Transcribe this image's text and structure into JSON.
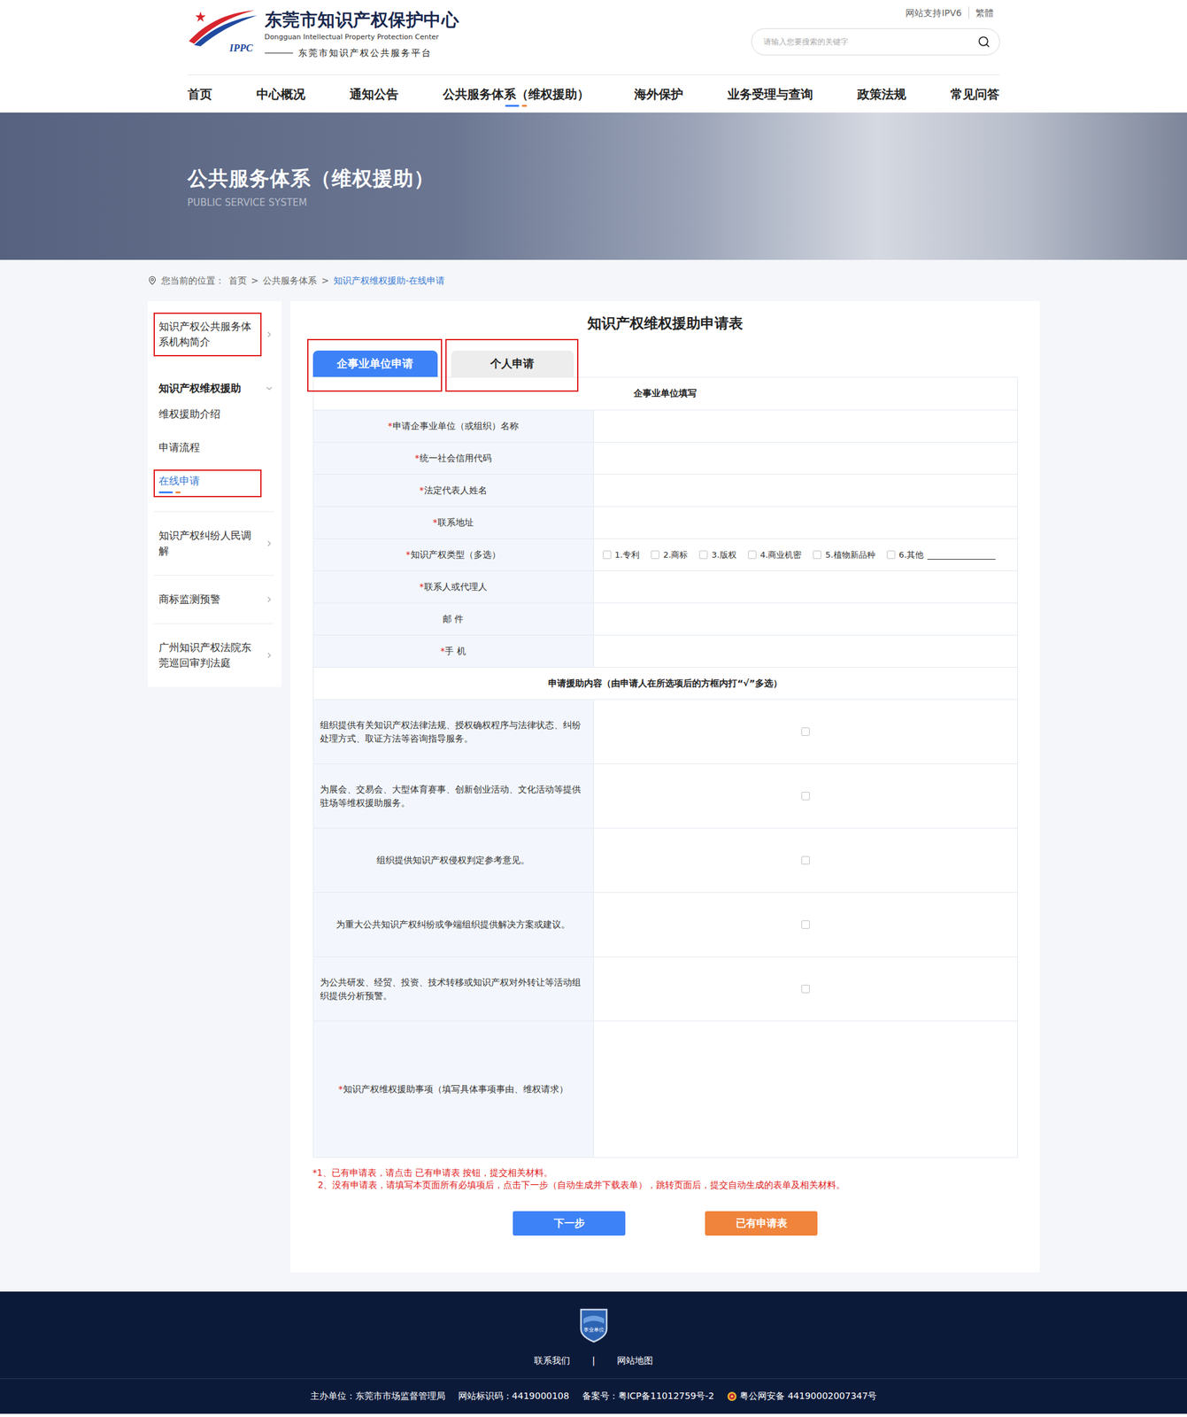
{
  "header": {
    "logo": {
      "badge": "IPPC",
      "title": "东莞市知识产权保护中心",
      "subtitle": "Dongguan Intellectual Property Protection Center",
      "platform": "东莞市知识产权公共服务平台"
    },
    "top_links": [
      "网站支持IPV6",
      "繁體"
    ],
    "search": {
      "placeholder": "请输入您要搜索的关键字"
    }
  },
  "nav": [
    {
      "label": "首页",
      "selected": false
    },
    {
      "label": "中心概况",
      "selected": false
    },
    {
      "label": "通知公告",
      "selected": false
    },
    {
      "label": "公共服务体系（维权援助）",
      "selected": true
    },
    {
      "label": "海外保护",
      "selected": false
    },
    {
      "label": "业务受理与查询",
      "selected": false
    },
    {
      "label": "政策法规",
      "selected": false
    },
    {
      "label": "常见问答",
      "selected": false
    }
  ],
  "banner": {
    "title": "公共服务体系（维权援助）",
    "subtitle": "PUBLIC SERVICE SYSTEM"
  },
  "breadcrumb": {
    "prefix": "您当前的位置：",
    "separator": ">",
    "items": [
      {
        "label": "首页",
        "current": false
      },
      {
        "label": "公共服务体系",
        "current": false
      },
      {
        "label": "知识产权维权援助-在线申请",
        "current": true
      }
    ]
  },
  "sidebar": {
    "items": [
      {
        "label": "知识产权公共服务体系机构简介",
        "kind": "link",
        "expanded": false,
        "annotated": true,
        "children": []
      },
      {
        "label": "知识产权维权援助",
        "kind": "group",
        "expanded": true,
        "annotated": false,
        "children": [
          {
            "label": "维权援助介绍",
            "selected": false,
            "annotated": false
          },
          {
            "label": "申请流程",
            "selected": false,
            "annotated": false
          },
          {
            "label": "在线申请",
            "selected": true,
            "annotated": true
          }
        ]
      },
      {
        "label": "知识产权纠纷人民调解",
        "kind": "link",
        "expanded": false,
        "annotated": false,
        "children": []
      },
      {
        "label": "商标监测预警",
        "kind": "link",
        "expanded": false,
        "annotated": false,
        "children": []
      },
      {
        "label": "广州知识产权法院东莞巡回审判法庭",
        "kind": "link",
        "expanded": false,
        "annotated": false,
        "children": []
      }
    ]
  },
  "form": {
    "title": "知识产权维权援助申请表",
    "required_mark": "*",
    "tabs": [
      {
        "label": "企事业单位申请",
        "selected": true,
        "annotated": true
      },
      {
        "label": "个人申请",
        "selected": false,
        "annotated": true
      }
    ],
    "section": "企事业单位填写",
    "fields": [
      {
        "label": "申请企事业单位（或组织）名称",
        "required": true,
        "kind": "text",
        "value": "",
        "options": []
      },
      {
        "label": "统一社会信用代码",
        "required": true,
        "kind": "text",
        "value": "",
        "options": []
      },
      {
        "label": "法定代表人姓名",
        "required": true,
        "kind": "text",
        "value": "",
        "options": []
      },
      {
        "label": "联系地址",
        "required": true,
        "kind": "text",
        "value": "",
        "options": []
      },
      {
        "label": "知识产权类型（多选）",
        "required": true,
        "kind": "options",
        "value": "",
        "options": [
          {
            "label": "1.专利",
            "checked": false,
            "blank": false
          },
          {
            "label": "2.商标",
            "checked": false,
            "blank": false
          },
          {
            "label": "3.版权",
            "checked": false,
            "blank": false
          },
          {
            "label": "4.商业机密",
            "checked": false,
            "blank": false
          },
          {
            "label": "5.植物新品种",
            "checked": false,
            "blank": false
          },
          {
            "label": "6.其他",
            "checked": false,
            "blank": true
          }
        ]
      },
      {
        "label": "联系人或代理人",
        "required": true,
        "kind": "text",
        "value": "",
        "options": []
      },
      {
        "label": "邮 件",
        "required": false,
        "kind": "text",
        "value": "",
        "options": []
      },
      {
        "label": "手 机",
        "required": true,
        "kind": "text",
        "value": "",
        "options": []
      }
    ],
    "assistance": {
      "title": "申请援助内容（由申请人在所选项后的方框内打“√”多选）",
      "items": [
        {
          "label": "组织提供有关知识产权法律法规、授权确权程序与法律状态、纠纷处理方式、取证方法等咨询指导服务。",
          "checked": false
        },
        {
          "label": "为展会、交易会、大型体育赛事、创新创业活动、文化活动等提供驻场等维权援助服务。",
          "checked": false
        },
        {
          "label": "组织提供知识产权侵权判定参考意见。",
          "checked": false
        },
        {
          "label": "为重大公共知识产权纠纷或争端组织提供解决方案或建议。",
          "checked": false
        },
        {
          "label": "为公共研发、经贸、投资、技术转移或知识产权对外转让等活动组织提供分析预警。",
          "checked": false
        }
      ]
    },
    "matter": {
      "label": "知识产权维权援助事项（填写具体事项事由、维权请求）",
      "required": true,
      "value": ""
    },
    "notes": [
      {
        "text": "*1、已有申请表，请点击 已有申请表 按钮，提交相关材料。",
        "indent": false
      },
      {
        "text": "2、没有申请表，请填写本页面所有必填项后，点击下一步（自动生成并下载表单），跳转页面后，提交自动生成的表单及相关材料。",
        "indent": true
      }
    ],
    "buttons": [
      {
        "label": "下一步",
        "kind": "primary"
      },
      {
        "label": "已有申请表",
        "kind": "secondary"
      }
    ]
  },
  "footer": {
    "emblem": "事业单位",
    "links": [
      "联系我们",
      "网站地图"
    ],
    "separator": "|",
    "info": [
      {
        "text": "主办单位：东莞市市场监督管理局",
        "kind": "plain"
      },
      {
        "text": "网站标识码：4419000108",
        "kind": "plain"
      },
      {
        "text": "备案号：粤ICP备11012759号-2",
        "kind": "plain"
      },
      {
        "text": "粤公网安备 44190002007347号",
        "kind": "police"
      }
    ]
  }
}
